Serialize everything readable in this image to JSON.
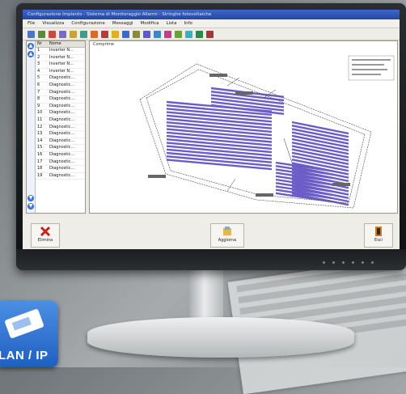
{
  "window": {
    "title": "Configurazione Impianto - Sistema di Monitoraggio Allarmi - Stringhe fotovoltaiche"
  },
  "menu": [
    "File",
    "Visualizza",
    "Configurazione",
    "Messaggi",
    "Modifica",
    "Lista",
    "Info"
  ],
  "toolbar_icons": [
    "new-icon",
    "open-icon",
    "save-icon",
    "print-icon",
    "edit-icon",
    "flag-icon",
    "zoom-icon",
    "alarm-icon",
    "warning-icon",
    "link-icon",
    "key-icon",
    "grid-icon",
    "report-icon",
    "chart-icon",
    "settings-icon",
    "help-icon",
    "globe-icon",
    "exit-icon"
  ],
  "list": {
    "headers": {
      "num": "Nr",
      "name": "Nome"
    },
    "rows": [
      {
        "num": "1",
        "name": "Inverter N..."
      },
      {
        "num": "2",
        "name": "Inverter N..."
      },
      {
        "num": "3",
        "name": "Inverter N..."
      },
      {
        "num": "4",
        "name": "Inverter N..."
      },
      {
        "num": "5",
        "name": "Diagnostic..."
      },
      {
        "num": "6",
        "name": "Diagnostic..."
      },
      {
        "num": "7",
        "name": "Diagnostic..."
      },
      {
        "num": "8",
        "name": "Diagnostic..."
      },
      {
        "num": "9",
        "name": "Diagnostic..."
      },
      {
        "num": "10",
        "name": "Diagnostic..."
      },
      {
        "num": "11",
        "name": "Diagnostic..."
      },
      {
        "num": "12",
        "name": "Diagnostic..."
      },
      {
        "num": "13",
        "name": "Diagnostic..."
      },
      {
        "num": "14",
        "name": "Diagnostic..."
      },
      {
        "num": "15",
        "name": "Diagnostic..."
      },
      {
        "num": "16",
        "name": "Diagnostic..."
      },
      {
        "num": "17",
        "name": "Diagnostic..."
      },
      {
        "num": "18",
        "name": "Diagnostic..."
      },
      {
        "num": "19",
        "name": "Diagnostic..."
      }
    ]
  },
  "map_panel": {
    "label": "Comprime"
  },
  "buttons": {
    "left": "Elimina",
    "middle": "Aggiorna",
    "right": "Esci"
  },
  "badge": {
    "text": "LAN / IP"
  },
  "colors": {
    "titlebar": "#2a55bb",
    "panel_rows": "#6b5cc8",
    "badge": "#2f74d4"
  }
}
